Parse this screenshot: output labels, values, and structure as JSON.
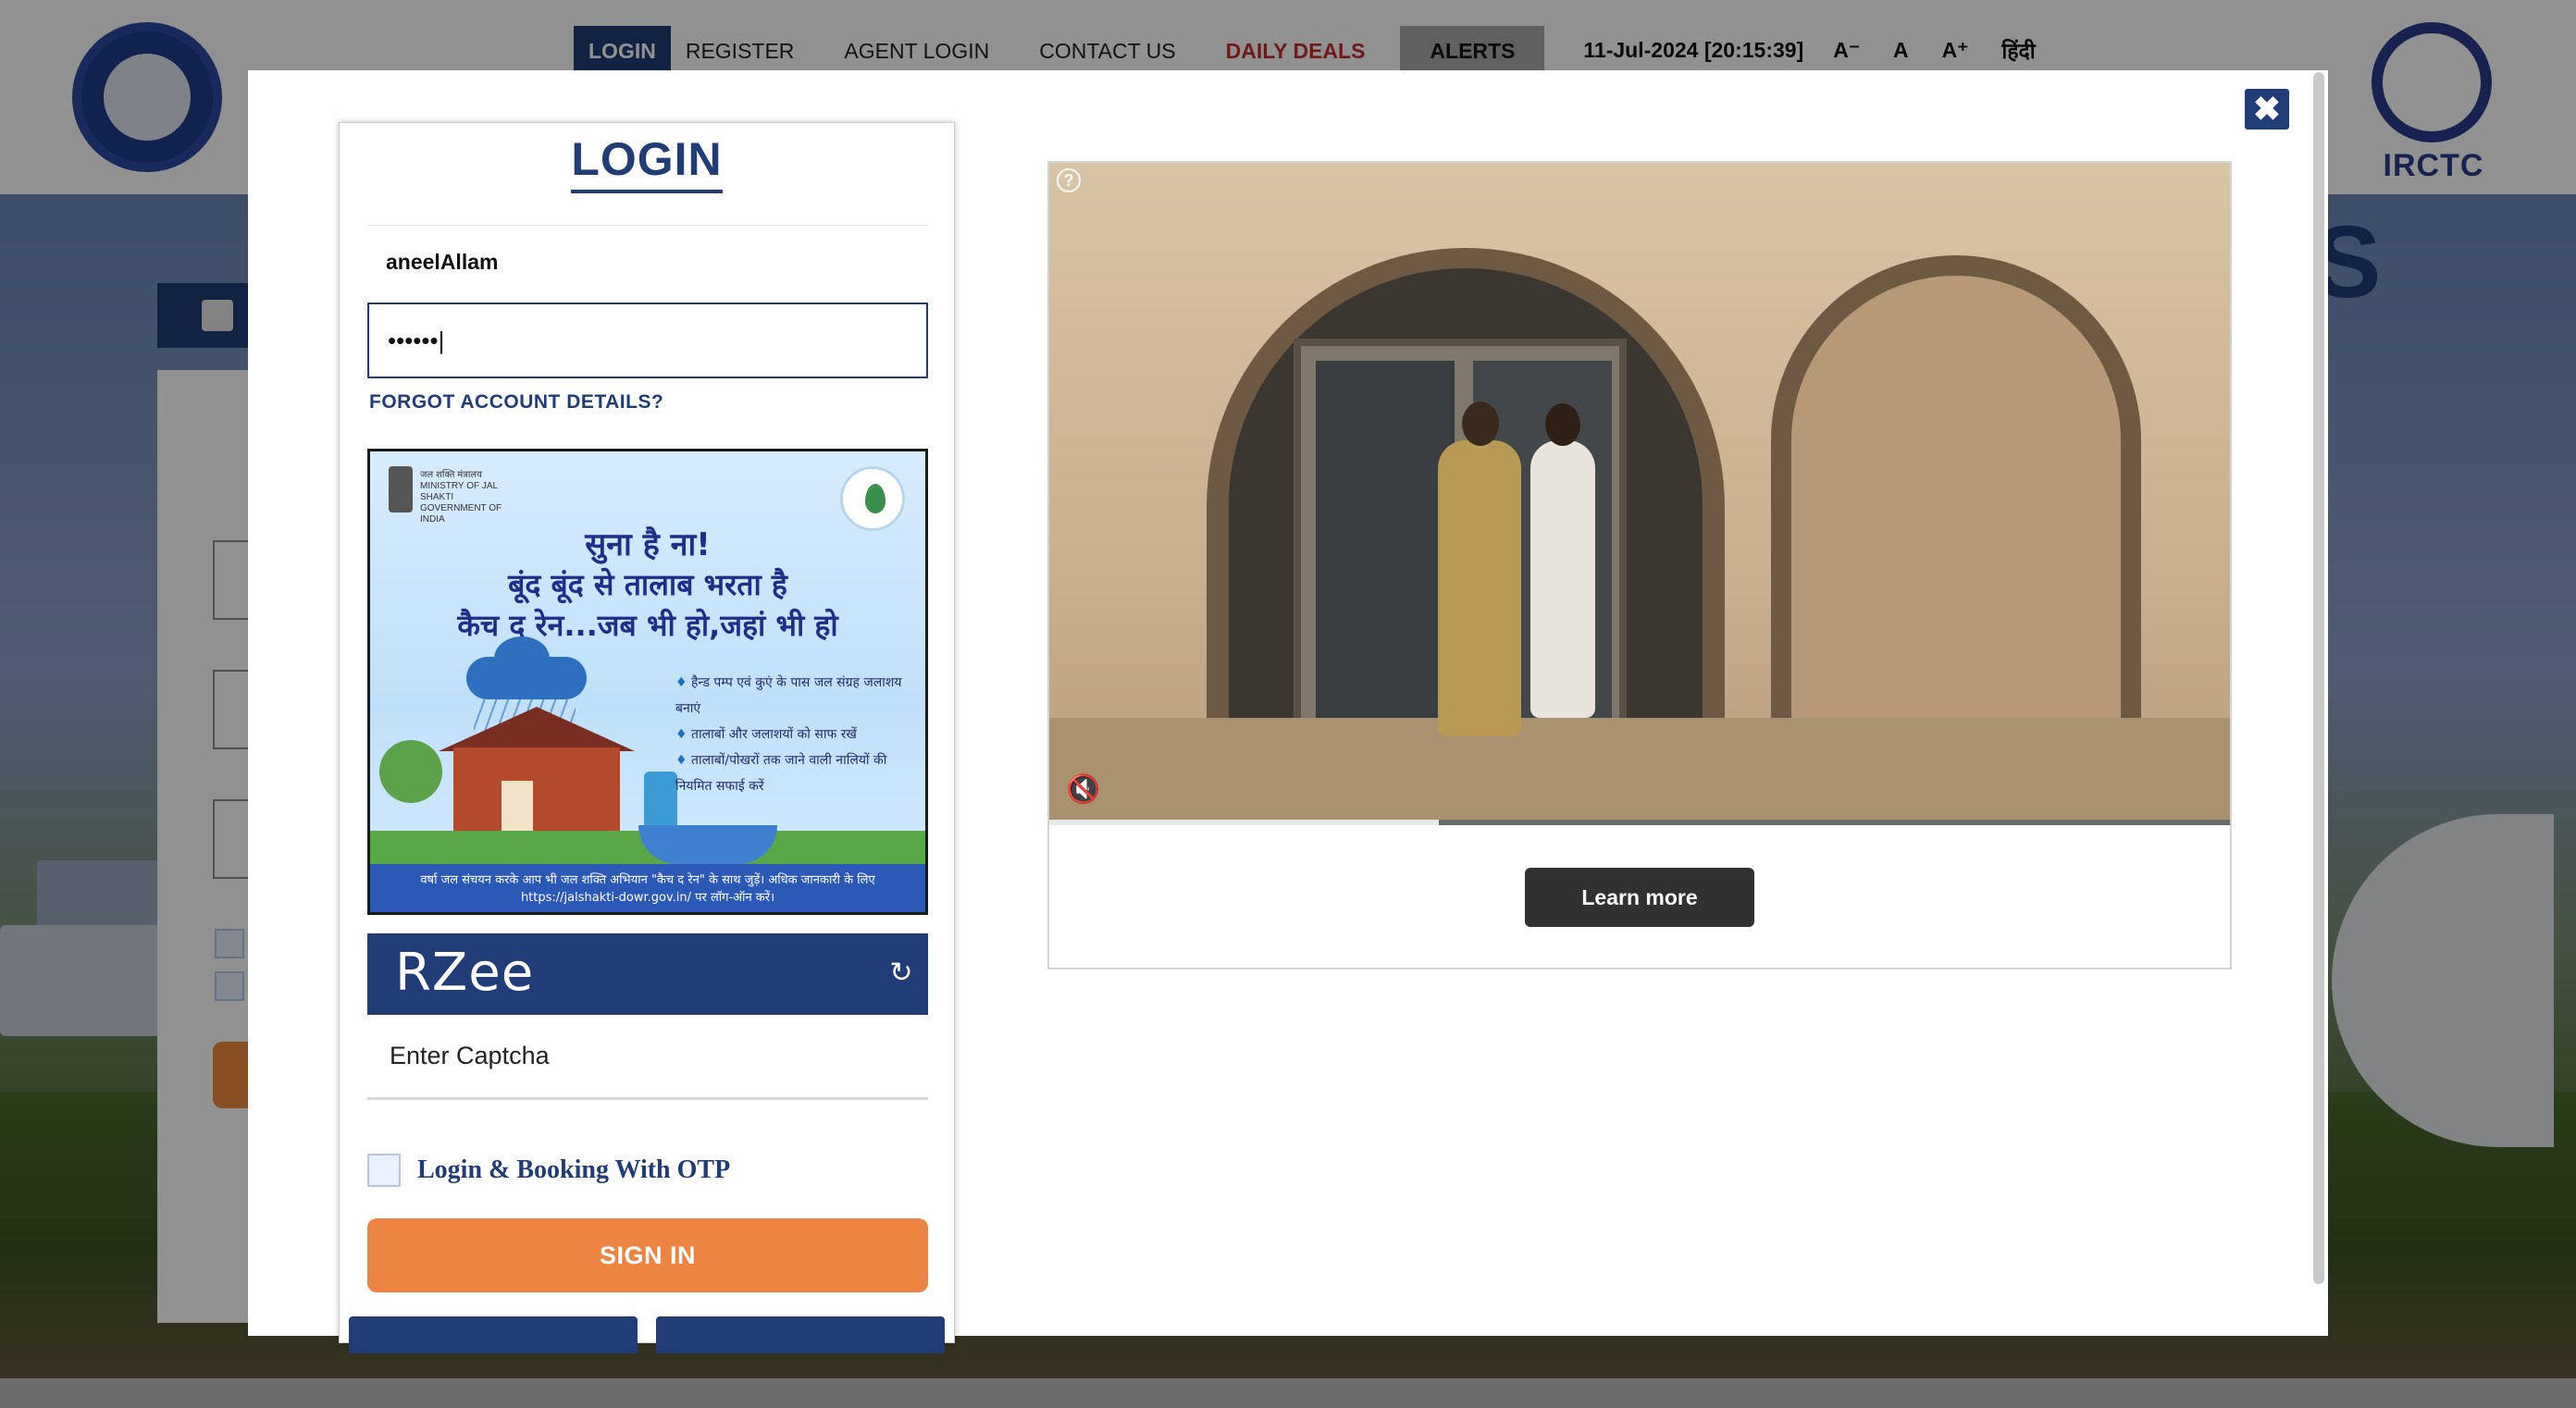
{
  "nav": {
    "items": [
      {
        "label": "LOGIN"
      },
      {
        "label": "REGISTER"
      },
      {
        "label": "AGENT LOGIN"
      },
      {
        "label": "CONTACT US"
      },
      {
        "label": "DAILY DEALS"
      },
      {
        "label": "ALERTS"
      }
    ],
    "datetime": "11-Jul-2024 [20:15:39]",
    "font_small": "A⁻",
    "font_normal": "A",
    "font_large": "A⁺",
    "language": "हिंदी"
  },
  "logos": {
    "irctc": "IRCTC",
    "ir_icon": "indian-railways-emblem-icon"
  },
  "background": {
    "partial_heading": "S"
  },
  "login": {
    "title": "LOGIN",
    "username_value": "aneelAllam",
    "password_value": "••••••|",
    "forgot_label": "FORGOT ACCOUNT DETAILS?",
    "captcha_text": "RZee",
    "captcha_placeholder": "Enter Captcha",
    "otp_label": "Login & Booking With OTP",
    "otp_checked": false,
    "signin_label": "SIGN IN"
  },
  "ad_banner": {
    "ministry": "जल शक्ति मंत्रालय MINISTRY OF JAL SHAKTI GOVERNMENT OF INDIA",
    "line1": "सुना है ना!",
    "line2": "बूंद बूंद से तालाब भरता है",
    "line3": "कैच द रेन...जब भी हो,जहां भी हो",
    "bullets": [
      "हैन्ड पम्प एवं कुएं के पास जल संग्रह जलाशय बनाएं",
      "तालाबों और जलाशयों को साफ रखें",
      "तालाबों/पोखरों तक जाने वाली नालियों की नियमित सफाई करें"
    ],
    "footer": "वर्षा जल संचयन करके आप भी जल शक्ति अभियान \"कैच द रेन\" के साथ जुड़ें। अधिक जानकारी के लिए https://jalshakti-dowr.gov.in/ पर लॉग-ऑन करें।"
  },
  "video_ad": {
    "help_glyph": "?",
    "mute_glyph": "🔇",
    "progress": 0.33,
    "learn_more": "Learn more"
  },
  "modal": {
    "close_glyph": "✖"
  },
  "colors": {
    "brand_navy": "#213d77",
    "accent_orange": "#ee8442",
    "deals_red": "#c62d2d"
  }
}
